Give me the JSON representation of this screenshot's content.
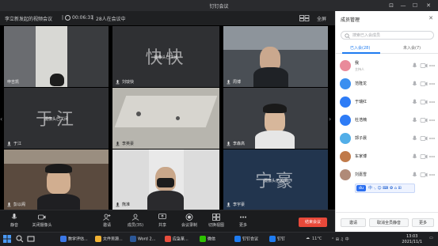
{
  "window": {
    "title": "钉钉会议"
  },
  "window_controls": {
    "pin": "⊡",
    "minimize": "—",
    "maximize": "☐",
    "close": "✕"
  },
  "infobar": {
    "meeting_title": "李立新发起的视频会议",
    "timer": "00:06:31",
    "participants_status": "28人在会议中",
    "fullscreen_label": "全屏"
  },
  "tiles": [
    {
      "name": "申吉凯"
    },
    {
      "name": "刘琰快",
      "big": "快快",
      "camoff": "摄像头已关闭"
    },
    {
      "name": "周博"
    },
    {
      "name": "于江",
      "big": "于江",
      "camoff": "摄像头已关闭"
    },
    {
      "name": "李英豪"
    },
    {
      "name": "李森高"
    },
    {
      "name": "彭以阁"
    },
    {
      "name": "熊准"
    },
    {
      "name": "李宇豪",
      "big": "宁豪",
      "camoff": "摄像头已关闭"
    }
  ],
  "toolbar": {
    "mute": "静音",
    "camera": "关闭摄像头",
    "invite": "邀请",
    "members": "成员(35)",
    "share": "共享",
    "record": "会议录制",
    "switch_view": "切换视图",
    "more": "更多",
    "end_meeting": "结束会议"
  },
  "panel": {
    "title": "成员管理",
    "close": "✕",
    "search_placeholder": "搜索已入会成员",
    "tab_joined": "已入会(28)",
    "tab_not_joined": "未入会(7)",
    "members": [
      {
        "name": "我",
        "sub": "主持人",
        "color": "#e98a9a"
      },
      {
        "name": "范隆龙",
        "sub": "",
        "color": "#3a8ff0"
      },
      {
        "name": "于瑞红",
        "sub": "",
        "color": "#2e7cf6"
      },
      {
        "name": "杜浩楠",
        "sub": "",
        "color": "#2e7cf6"
      },
      {
        "name": "郭子晨",
        "sub": "",
        "color": "#52aee8"
      },
      {
        "name": "车家博",
        "sub": "",
        "color": "#c07a4a"
      },
      {
        "name": "刘嘉雪",
        "sub": "",
        "color": "#b08a78"
      }
    ],
    "ime_logo": "du",
    "ime_text": "中 ·, ☺ ⌨ ✿ ⌂ ⊞",
    "footer": {
      "invite": "邀请",
      "mute_all": "取消全员静音",
      "more": "更多"
    }
  },
  "taskbar": {
    "apps": [
      {
        "label": "数学评估...",
        "color": "#3b78e7"
      },
      {
        "label": "文件资源...",
        "color": "#f2b233"
      },
      {
        "label": "Word 2...",
        "color": "#2b5797"
      },
      {
        "label": "应急篆...",
        "color": "#e84d3d"
      },
      {
        "label": "微信",
        "color": "#2dc100"
      },
      {
        "label": "钉钉会议",
        "color": "#1e7bf0"
      },
      {
        "label": "钉钉",
        "color": "#1e7bf0"
      }
    ],
    "temperature": "11°C",
    "time": "13:03",
    "date": "2021/11/1"
  }
}
